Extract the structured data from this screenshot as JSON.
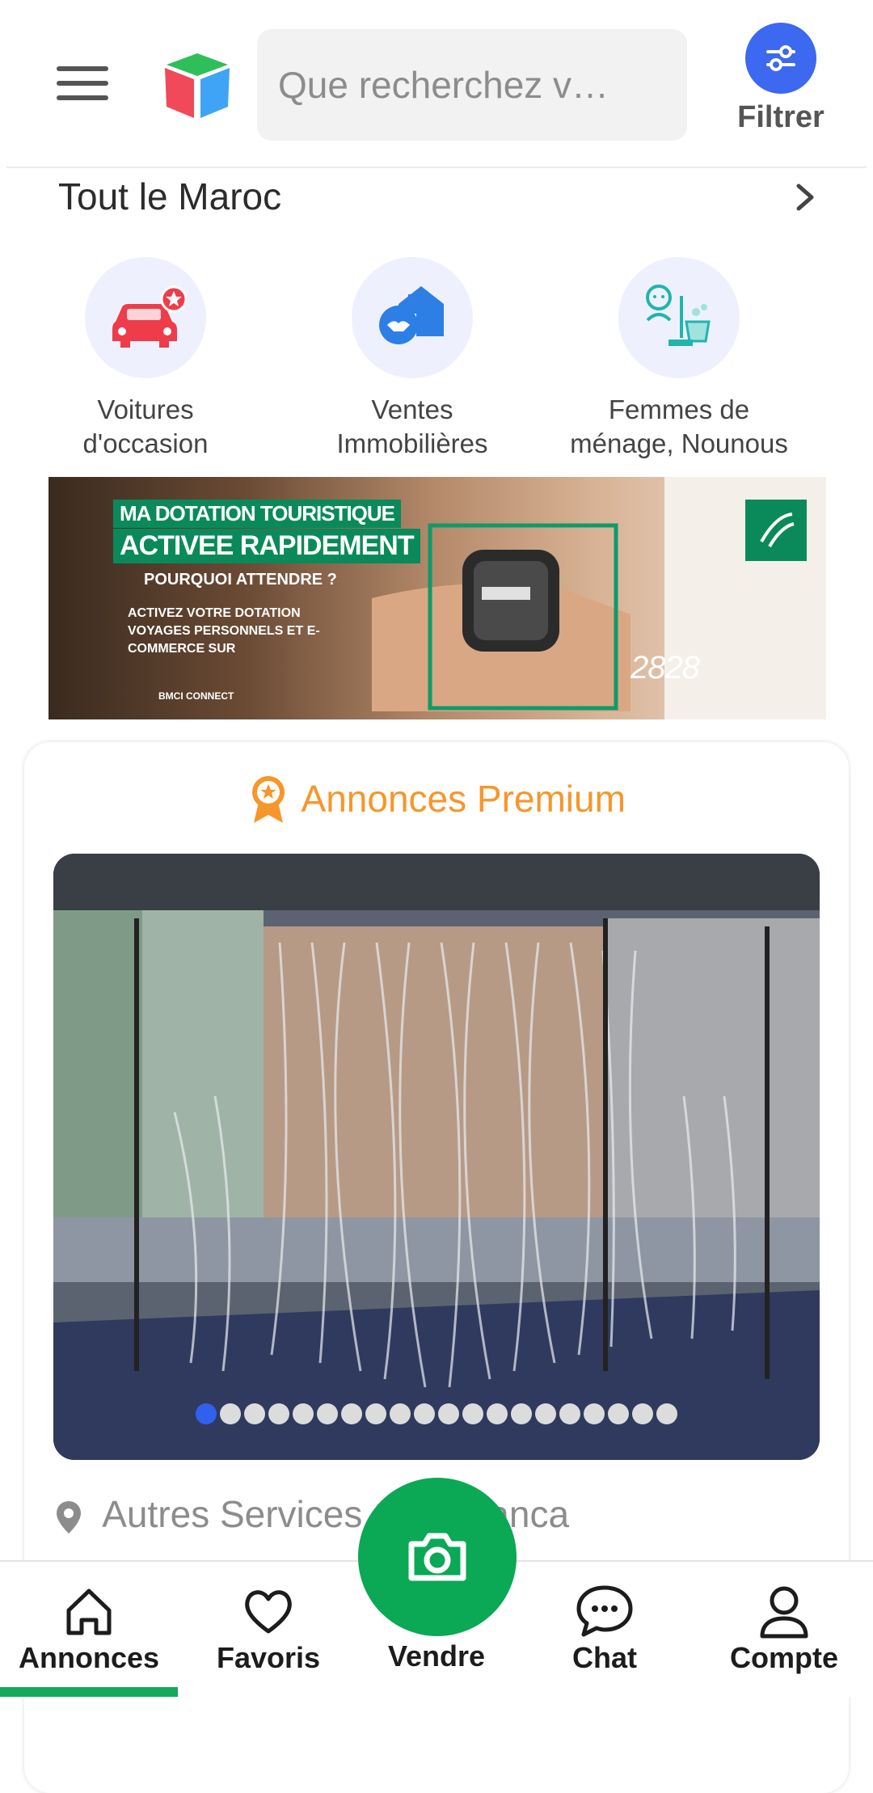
{
  "header": {
    "menu_icon": "hamburger-menu-icon",
    "logo_icon": "app-cube-logo",
    "search_placeholder": "Que recherchez v…",
    "filter_label": "Filtrer",
    "filter_icon": "sliders-icon",
    "accent_color": "#3d68f0"
  },
  "location": {
    "label": "Tout le Maroc",
    "chevron_icon": "chevron-right-icon"
  },
  "categories": [
    {
      "label": "Voitures\nd'occasion",
      "icon": "car-star-icon"
    },
    {
      "label": "Ventes\nImmobilières",
      "icon": "house-handshake-icon"
    },
    {
      "label": "Femmes de\nménage, Nounous",
      "icon": "nanny-cleaning-icon"
    }
  ],
  "banner": {
    "headline_1": "MA DOTATION TOURISTIQUE",
    "headline_2": "ACTIVEE RAPIDEMENT",
    "subline": "POURQUOI ATTENDRE ?",
    "body": "ACTIVEZ VOTRE DOTATION VOYAGES PERSONNELS ET E-COMMERCE SUR",
    "brand": "BMCI CONNECT",
    "phone": "2828"
  },
  "premium": {
    "title": "Annonces Premium",
    "title_icon": "medal-star-icon",
    "accent_color": "#f7962a",
    "carousel_total": 20,
    "carousel_active": 1,
    "listing_location": "Autres Services      Casablanca",
    "pin_icon": "location-pin-icon"
  },
  "bottom_nav": {
    "items": [
      {
        "label": "Annonces",
        "icon": "home-icon",
        "active": true
      },
      {
        "label": "Favoris",
        "icon": "heart-icon",
        "active": false
      },
      {
        "label": "Vendre",
        "icon": "camera-icon",
        "active": false
      },
      {
        "label": "Chat",
        "icon": "chat-bubble-icon",
        "active": false
      },
      {
        "label": "Compte",
        "icon": "user-icon",
        "active": false
      }
    ],
    "active_color": "#15a85a",
    "sell_color": "#0ba855"
  }
}
